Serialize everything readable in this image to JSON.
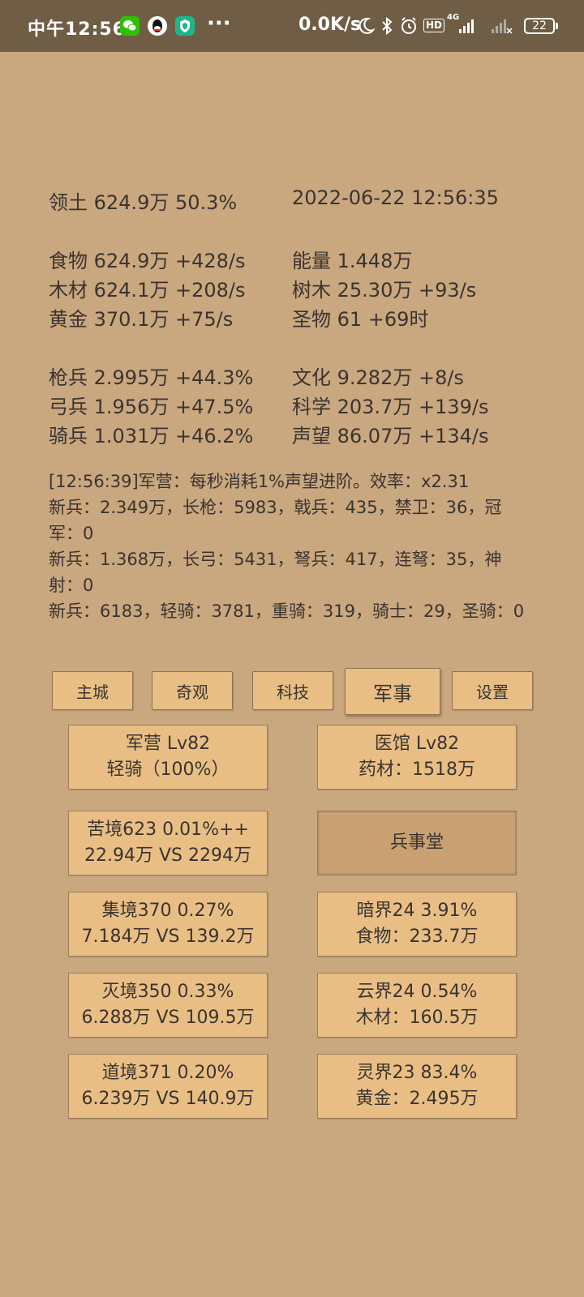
{
  "status_bar": {
    "time": "中午12:56",
    "apps": [
      "wechat-icon",
      "qq-icon",
      "shield-icon"
    ],
    "more": "···",
    "net_speed": "0.0K/s",
    "icons": [
      "moon-icon",
      "bluetooth-icon",
      "alarm-icon",
      "hd-icon",
      "signal-4g-icon",
      "signal-no-service-icon"
    ],
    "hd": "HD",
    "network": "4G",
    "battery": "22"
  },
  "summary": {
    "territory": "领土  624.9万  50.3%",
    "datetime": "2022-06-22 12:56:35"
  },
  "resources": {
    "left": [
      "食物  624.9万 +428/s",
      "木材  624.1万 +208/s",
      "黄金  370.1万 +75/s"
    ],
    "right": [
      "能量  1.448万",
      "树木  25.30万 +93/s",
      "圣物  61 +69时"
    ]
  },
  "army": {
    "left": [
      "枪兵  2.995万 +44.3%",
      "弓兵  1.956万 +47.5%",
      "骑兵  1.031万 +46.2%"
    ],
    "right": [
      "文化  9.282万 +8/s",
      "科学  203.7万 +139/s",
      "声望  86.07万 +134/s"
    ]
  },
  "log": [
    "[12:56:39]军营：每秒消耗1%声望进阶。效率：x2.31",
    "新兵：2.349万，长枪：5983，戟兵：435，禁卫：36，冠军：0",
    "新兵：1.368万，长弓：5431，弩兵：417，连弩：35，神射：0",
    "新兵：6183，轻骑：3781，重骑：319，骑士：29，圣骑：0"
  ],
  "tabs": [
    "主城",
    "奇观",
    "科技",
    "军事",
    "设置"
  ],
  "active_tab": "军事",
  "buildings": [
    {
      "line1": "军营 Lv82",
      "line2": "轻骑（100%）"
    },
    {
      "line1": "医馆 Lv82",
      "line2": "药材：1518万"
    },
    {
      "line1": "苦境623  0.01%++",
      "line2": "22.94万 VS 2294万"
    },
    {
      "line1": "兵事堂",
      "line2": ""
    },
    {
      "line1": "集境370  0.27%",
      "line2": "7.184万 VS 139.2万"
    },
    {
      "line1": "暗界24  3.91%",
      "line2": "食物：233.7万"
    },
    {
      "line1": "灭境350  0.33%",
      "line2": "6.288万 VS 109.5万"
    },
    {
      "line1": "云界24  0.54%",
      "line2": "木材：160.5万"
    },
    {
      "line1": "道境371  0.20%",
      "line2": "6.239万 VS 140.9万"
    },
    {
      "line1": "灵界23  83.4%",
      "line2": "黄金：2.495万"
    }
  ]
}
